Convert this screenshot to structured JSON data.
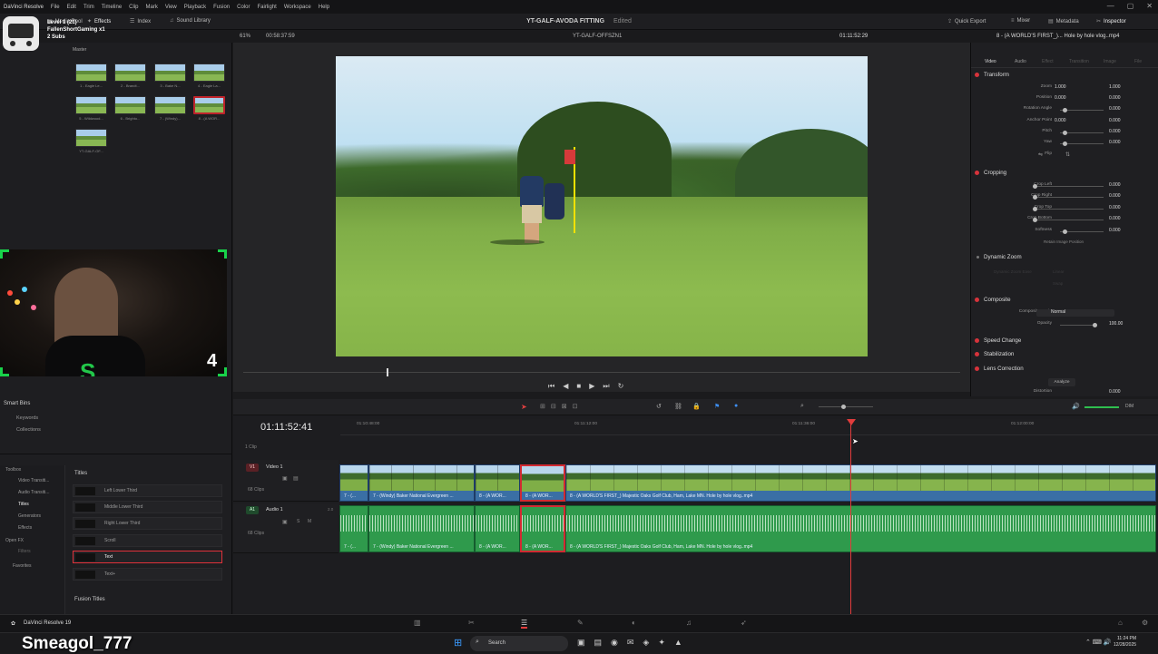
{
  "menubar": {
    "items": [
      "DaVinci Resolve",
      "File",
      "Edit",
      "Trim",
      "Timeline",
      "Clip",
      "Mark",
      "View",
      "Playback",
      "Fusion",
      "Color",
      "Fairlight",
      "Workspace",
      "Help"
    ]
  },
  "toolbar": {
    "media_pool": "Media Pool",
    "effects": "Effects",
    "index": "Index",
    "sound_library": "Sound Library",
    "project_title": "YT-GALF-AVODA FITTING",
    "edited": "Edited",
    "quick_export": "Quick Export",
    "mixer": "Mixer",
    "metadata": "Metadata",
    "inspector": "Inspector"
  },
  "subbar": {
    "zoom": "61%",
    "timecode_left": "00:58:37:59",
    "timeline_name": "YT-GALF-OFFSZN1",
    "timecode_right": "01:11:52:29",
    "clip_name": "8 - (A WORLD'S FIRST_)... Hole by hole vlog..mp4"
  },
  "stream_overlay": {
    "level": "Level 1  (21)",
    "counter": "FallenShortGaming x1",
    "subs": "2 Subs",
    "master": "Master",
    "webcam_number": "4",
    "username": "Smeagol_777"
  },
  "media_pool": {
    "clips": [
      {
        "label": "1 - Eagle Le..."
      },
      {
        "label": "2 - Brandt..."
      },
      {
        "label": "3 - Bake N..."
      },
      {
        "label": "4 - Eagle La..."
      },
      {
        "label": "5 - Wildwood..."
      },
      {
        "label": "6 - Brighto..."
      },
      {
        "label": "7 - (Windy)..."
      },
      {
        "label": "8 - (A WOR..."
      },
      {
        "label": "YT-GALF-OF..."
      }
    ]
  },
  "smart_bins": {
    "title": "Smart Bins",
    "items": [
      "Keywords",
      "Collections"
    ]
  },
  "effects_panel": {
    "toolbox": "Toolbox",
    "categories": [
      "Video Transiti...",
      "Audio Transiti...",
      "Titles",
      "Generators",
      "Effects",
      "Open FX",
      "Filters",
      "Favorites"
    ],
    "section": "Titles",
    "titles": [
      "Left Lower Third",
      "Middle Lower Third",
      "Right Lower Third",
      "Scroll",
      "Text",
      "Text+"
    ],
    "fusion_titles": "Fusion Titles"
  },
  "inspector": {
    "tabs": [
      "Video",
      "Audio",
      "Effect",
      "Transition",
      "Image",
      "File"
    ],
    "transform": {
      "title": "Transform",
      "zoom_label": "Zoom",
      "zoom_x": "1.000",
      "zoom_y": "1.000",
      "position_label": "Position",
      "position_x": "0.000",
      "position_y": "0.000",
      "rotation_label": "Rotation Angle",
      "rotation": "0.000",
      "anchor_label": "Anchor Point",
      "anchor_x": "0.000",
      "anchor_y": "0.000",
      "pitch_label": "Pitch",
      "pitch": "0.000",
      "yaw_label": "Yaw",
      "yaw": "0.000",
      "flip_label": "Flip"
    },
    "cropping": {
      "title": "Cropping",
      "left_label": "Crop Left",
      "left": "0.000",
      "right_label": "Crop Right",
      "right": "0.000",
      "top_label": "Crop Top",
      "top": "0.000",
      "bottom_label": "Crop Bottom",
      "bottom": "0.000",
      "softness_label": "Softness",
      "softness": "0.000",
      "retain": "Retain Image Position"
    },
    "dynamic_zoom": {
      "title": "Dynamic Zoom",
      "ease_label": "Dynamic Zoom Ease",
      "ease": "Linear",
      "swap": "Swap"
    },
    "composite": {
      "title": "Composite",
      "mode_label": "Composite Mode",
      "mode": "Normal",
      "opacity_label": "Opacity",
      "opacity": "100.00"
    },
    "speed_change": "Speed Change",
    "stabilization": "Stabilization",
    "lens_correction": {
      "title": "Lens Correction",
      "analyze": "Analyze",
      "distortion_label": "Distortion",
      "distortion": "0.000"
    }
  },
  "timeline": {
    "timecode": "01:11:52:41",
    "ruler": [
      "01:10:48:00",
      "01:11:12:00",
      "01:11:36:00",
      "01:12:00:00"
    ],
    "v1": {
      "id": "V1",
      "name": "Video 1",
      "clips": "68 Clips"
    },
    "a1": {
      "id": "A1",
      "name": "Audio 1",
      "clips": "68 Clips",
      "level": "2.0"
    },
    "one_clip": "1 Clip",
    "clip_labels": [
      "7 - (...",
      "7 - (Windy) Baker National Evergreen ...",
      "8 - (A WOR...",
      "8 - (A WOR...",
      "8 - (A WORLD'S FIRST_) Majestic Oaks Golf Club, Ham, Lake MN.  Hole by hole vlog..mp4"
    ],
    "audio_meter": "DIM"
  },
  "pagebar": {
    "app": "DaVinci Resolve 19"
  },
  "taskbar": {
    "search": "Search",
    "time": "11:24 PM",
    "date": "12/28/2025"
  }
}
